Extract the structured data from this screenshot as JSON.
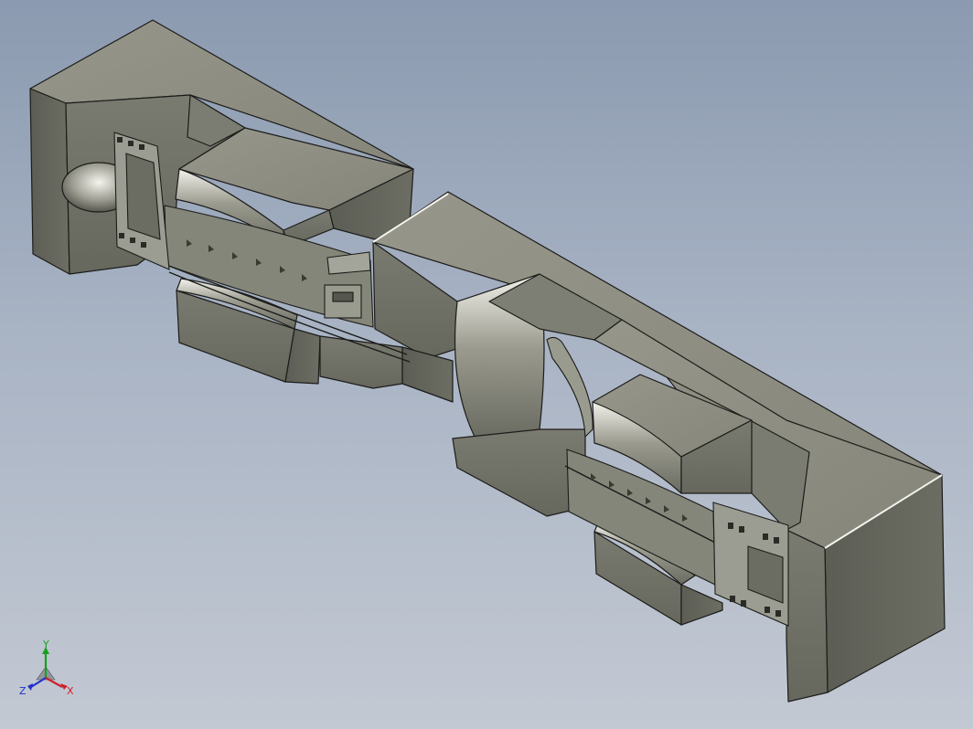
{
  "viewport": {
    "background_top": "#8b9ab0",
    "background_bottom": "#c3c9d3"
  },
  "model": {
    "face_top_color": "#8c8c80",
    "face_front_color": "#6f7065",
    "face_side_color": "#5f6057",
    "edge_color": "#1c1c1a",
    "highlight_color": "#f4f4ee"
  },
  "triad": {
    "x_label": "X",
    "y_label": "Y",
    "z_label": "Z",
    "x_color": "#d0202a",
    "y_color": "#18a020",
    "z_color": "#2030c8"
  }
}
